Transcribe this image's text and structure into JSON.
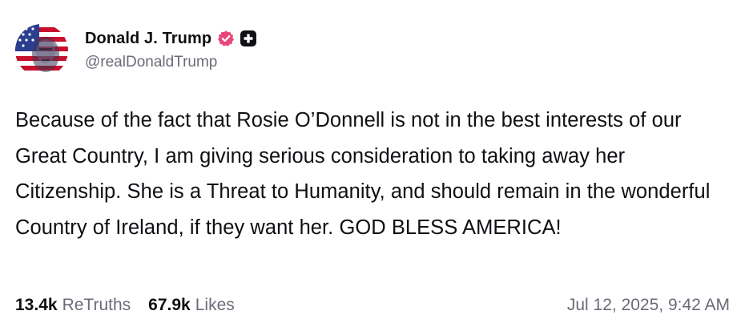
{
  "author": {
    "display_name": "Donald J. Trump",
    "handle": "@realDonaldTrump",
    "avatar_icon": "flag-portrait-avatar",
    "verified_icon": "verified-badge-icon",
    "plus_icon": "plus-badge-icon"
  },
  "post": {
    "text": "Because of the fact that Rosie O’Donnell is not in the best interests of our Great Country, I am giving serious consideration to taking away her Citizenship. She is a Threat to Humanity, and should remain in the wonderful Country of Ireland, if they want her. GOD BLESS AMERICA!"
  },
  "stats": {
    "retruths_count": "13.4k",
    "retruths_label": "ReTruths",
    "likes_count": "67.9k",
    "likes_label": "Likes"
  },
  "timestamp": "Jul 12, 2025, 9:42 AM",
  "colors": {
    "verified": "#e8477a",
    "text": "#0f0f14",
    "muted": "#6b6b78",
    "flag_red": "#c8102e",
    "flag_blue": "#2a3f8f"
  }
}
